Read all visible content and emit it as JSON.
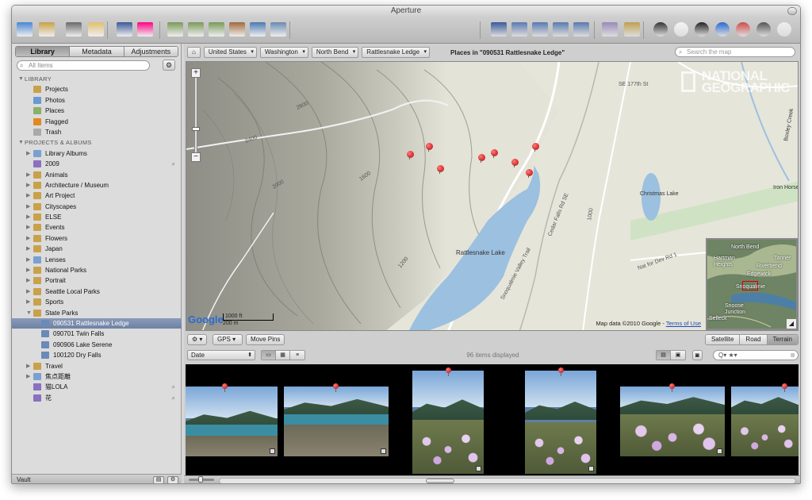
{
  "window": {
    "title": "Aperture"
  },
  "toolbar": {
    "left_icons": [
      "import-icon",
      "new-album-icon",
      "face-icon",
      "tag-icon",
      "facebook-icon",
      "flickr-icon",
      "rotate-left-icon",
      "rotate-right-icon",
      "stack-icon",
      "email-icon",
      "export-icon",
      "print-icon"
    ],
    "right_icons": [
      "viewer-icon",
      "split-view-icon",
      "grid-view-icon",
      "browser-view-icon",
      "filmstrip-icon",
      "faces-icon",
      "places-icon",
      "loupe-icon",
      "slideshow-icon",
      "info-icon",
      "inspector-icon",
      "reject-icon",
      "full-screen-icon",
      "hud-icon"
    ]
  },
  "sidebar": {
    "tabs": [
      "Library",
      "Metadata",
      "Adjustments"
    ],
    "active_tab": "Library",
    "search_placeholder": "All Items",
    "library_header": "LIBRARY",
    "library_items": [
      {
        "label": "Projects",
        "icon": "projects-icon"
      },
      {
        "label": "Photos",
        "icon": "photos-icon"
      },
      {
        "label": "Places",
        "icon": "places-icon"
      },
      {
        "label": "Flagged",
        "icon": "flag-icon"
      },
      {
        "label": "Trash",
        "icon": "trash-icon"
      }
    ],
    "projects_header": "PROJECTS & ALBUMS",
    "projects": [
      {
        "label": "Library Albums",
        "icon": "folder-icon",
        "expandable": true
      },
      {
        "label": "2009",
        "icon": "smart-album-icon",
        "expandable": false
      },
      {
        "label": "Animals",
        "icon": "project-icon",
        "expandable": true
      },
      {
        "label": "Architecture / Museum",
        "icon": "project-icon",
        "expandable": true
      },
      {
        "label": "Art Project",
        "icon": "project-icon",
        "expandable": true
      },
      {
        "label": "Cityscapes",
        "icon": "project-icon",
        "expandable": true
      },
      {
        "label": "ELSE",
        "icon": "project-icon",
        "expandable": true
      },
      {
        "label": "Events",
        "icon": "project-icon",
        "expandable": true
      },
      {
        "label": "Flowers",
        "icon": "project-icon",
        "expandable": true
      },
      {
        "label": "Japan",
        "icon": "project-icon",
        "expandable": true
      },
      {
        "label": "Lenses",
        "icon": "folder-icon",
        "expandable": true
      },
      {
        "label": "National Parks",
        "icon": "project-icon",
        "expandable": true
      },
      {
        "label": "Portrait",
        "icon": "project-icon",
        "expandable": true
      },
      {
        "label": "Seattle Local Parks",
        "icon": "project-icon",
        "expandable": true
      },
      {
        "label": "Sports",
        "icon": "project-icon",
        "expandable": true
      },
      {
        "label": "State Parks",
        "icon": "project-icon",
        "expandable": true,
        "expanded": true
      },
      {
        "label": "090531 Rattlesnake Ledge",
        "icon": "album-icon",
        "sub": true,
        "selected": true
      },
      {
        "label": "090701 Twin Falls",
        "icon": "album-icon",
        "sub": true
      },
      {
        "label": "090906 Lake Serene",
        "icon": "album-icon",
        "sub": true
      },
      {
        "label": "100120 Dry Falls",
        "icon": "album-icon",
        "sub": true
      },
      {
        "label": "Travel",
        "icon": "project-icon",
        "expandable": true
      },
      {
        "label": "焦点距離",
        "icon": "folder-icon",
        "expandable": true
      },
      {
        "label": "猫LOLA",
        "icon": "smart-album-icon",
        "expandable": false
      },
      {
        "label": "花",
        "icon": "smart-album-icon",
        "expandable": false
      }
    ],
    "footer_label": "Vault"
  },
  "pathbar": {
    "crumbs": [
      "United States",
      "Washington",
      "North Bend",
      "Rattlesnake Ledge"
    ],
    "title": "Places in \"090531 Rattlesnake Ledge\"",
    "search_placeholder": "Search the map"
  },
  "map": {
    "labels": {
      "lake": "Rattlesnake Lake",
      "christmas_lake": "Christmas Lake",
      "iron_horse": "Iron Horse State Park",
      "boxley": "Boxley Creek",
      "road_cedar": "Cedar Falls Rd SE",
      "road_177": "SE 177th St",
      "trail_snoqualmie": "Snoqualmie Valley Trail",
      "road_dev": "Nat for Dev Rd 1"
    },
    "contours": [
      "2400",
      "2000",
      "1600",
      "1200",
      "1000",
      "2800"
    ],
    "natgeo_line1": "NATIONAL",
    "natgeo_line2": "GEOGRAPHIC",
    "google": "Google",
    "scale_ft": "1000 ft",
    "scale_m": "200 m",
    "attribution": "Map data ©2010 Google -",
    "terms": "Terms of Use",
    "minimap_labels": [
      "North Bend",
      "Tanner",
      "Riverbend",
      "Edgewick",
      "Hartman Heights",
      "Snoqualmie",
      "Snoose Junction",
      "Selleck"
    ],
    "pin_color": "#d00000"
  },
  "map_controls": {
    "gear": "⚙",
    "gps": "GPS",
    "move_pins": "Move Pins",
    "views": [
      "Satellite",
      "Road",
      "Terrain"
    ],
    "active_view": "Terrain"
  },
  "browser": {
    "sort": "Date",
    "items_count": "96 items displayed",
    "filter_text": "Q▾ ★▾"
  }
}
